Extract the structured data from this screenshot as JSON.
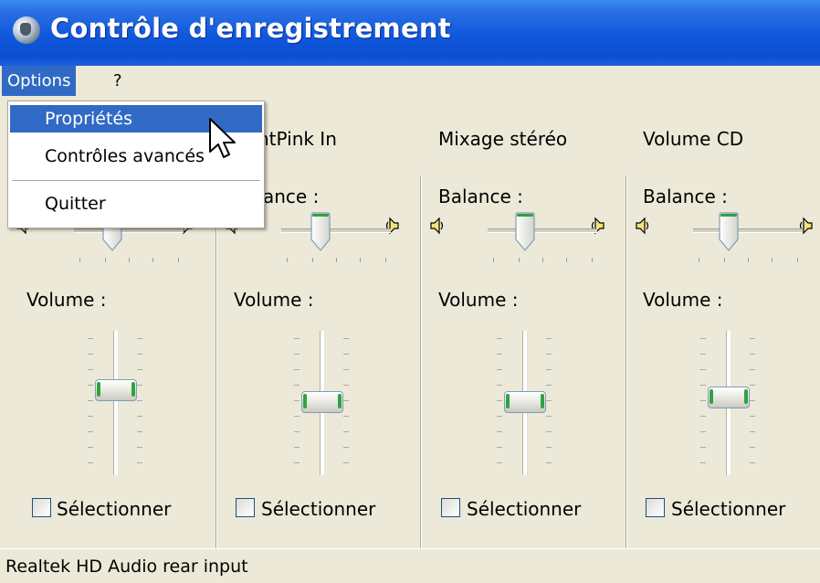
{
  "window": {
    "title": "Contrôle d'enregistrement"
  },
  "menubar": {
    "options": "Options",
    "help": "?"
  },
  "dropdown": {
    "items": [
      "Propriétés",
      "Contrôles avancés",
      "Quitter"
    ]
  },
  "columns": [
    {
      "name": "",
      "balance_label": "",
      "volume_label": "Volume :",
      "select_label": "Sélectionner"
    },
    {
      "name": "ntPink In",
      "balance_label": "ance :",
      "volume_label": "Volume :",
      "select_label": "Sélectionner"
    },
    {
      "name": "Mixage stéréo",
      "balance_label": "Balance :",
      "volume_label": "Volume :",
      "select_label": "Sélectionner"
    },
    {
      "name": "Volume CD",
      "balance_label": "Balance :",
      "volume_label": "Volume :",
      "select_label": "Sélectionner"
    }
  ],
  "status": {
    "text": "Realtek HD Audio rear input"
  },
  "colors": {
    "titlebar": "#0b4fd1",
    "selection": "#316ac5",
    "slider_grip": "#2fa33f"
  },
  "icons": [
    "window-app-icon",
    "speaker-left-icon",
    "speaker-right-icon",
    "mouse-cursor-icon"
  ]
}
